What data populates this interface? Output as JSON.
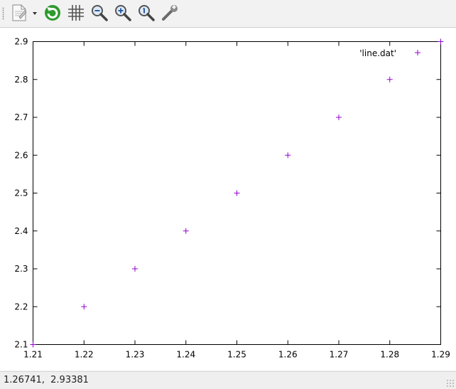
{
  "toolbar": {
    "buttons": [
      {
        "icon": "export-document-icon",
        "has_dropdown": true
      },
      {
        "icon": "replot-icon"
      },
      {
        "icon": "grid-icon"
      },
      {
        "icon": "zoom-previous-icon"
      },
      {
        "icon": "zoom-next-icon"
      },
      {
        "icon": "unzoom-icon"
      },
      {
        "icon": "settings-wrench-icon"
      }
    ]
  },
  "status": {
    "coordinates": "1.26741,  2.93381"
  },
  "colors": {
    "series": "#9400d3",
    "axis": "#000000",
    "background": "#ffffff"
  },
  "chart_data": {
    "type": "scatter",
    "title": "",
    "xlabel": "",
    "ylabel": "",
    "xlim": [
      1.21,
      1.29
    ],
    "ylim": [
      2.1,
      2.9
    ],
    "xticks": [
      "1.21",
      "1.22",
      "1.23",
      "1.24",
      "1.25",
      "1.26",
      "1.27",
      "1.28",
      "1.29"
    ],
    "yticks": [
      "2.1",
      "2.2",
      "2.3",
      "2.4",
      "2.5",
      "2.6",
      "2.7",
      "2.8",
      "2.9"
    ],
    "grid": false,
    "legend_position": "top-right",
    "series": [
      {
        "name": "'line.dat'",
        "marker": "+",
        "x": [
          1.21,
          1.22,
          1.23,
          1.24,
          1.25,
          1.26,
          1.27,
          1.28,
          1.29
        ],
        "y": [
          2.1,
          2.2,
          2.3,
          2.4,
          2.5,
          2.6,
          2.7,
          2.8,
          2.9
        ]
      }
    ]
  }
}
